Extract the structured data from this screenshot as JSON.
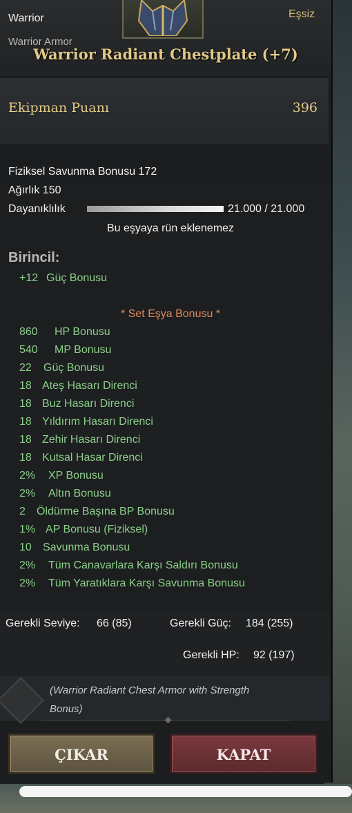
{
  "header": {
    "class": "Warrior",
    "armor_type": "Warrior Armor",
    "rarity": "Eşsiz",
    "item_name": "Warrior Radiant Chestplate (+7)"
  },
  "equipment_points": {
    "label": "Ekipman Puanı",
    "value": "396"
  },
  "stats": {
    "defense": "Fiziksel Savunma Bonusu 172",
    "weight": "Ağırlık 150",
    "durability_label": "Dayanıklılık",
    "durability_value": "21.000 / 21.000",
    "durability_fraction": 1.0,
    "no_rune": "Bu eşyaya rün eklenemez"
  },
  "primary": {
    "title": "Birincil:",
    "bonus_value": "+12",
    "bonus_name": "Güç Bonusu"
  },
  "set_bonus": {
    "title": "* Set Eşya Bonusu *",
    "items": [
      {
        "value": "860",
        "name": "HP Bonusu"
      },
      {
        "value": "540",
        "name": "MP Bonusu"
      },
      {
        "value": "22",
        "name": "Güç Bonusu"
      },
      {
        "value": "18",
        "name": "Ateş Hasarı Direnci"
      },
      {
        "value": "18",
        "name": "Buz Hasarı Direnci"
      },
      {
        "value": "18",
        "name": "Yıldırım Hasarı Direnci"
      },
      {
        "value": "18",
        "name": "Zehir Hasarı Direnci"
      },
      {
        "value": "18",
        "name": "Kutsal Hasar Direnci"
      },
      {
        "value": "2%",
        "name": "XP Bonusu"
      },
      {
        "value": "2%",
        "name": "Altın Bonusu"
      },
      {
        "value": "2",
        "name": "Öldürme Başına BP Bonusu"
      },
      {
        "value": "1%",
        "name": "AP Bonusu (Fiziksel)"
      },
      {
        "value": "10",
        "name": "Savunma Bonusu"
      },
      {
        "value": "2%",
        "name": "Tüm Canavarlara Karşı Saldırı Bonusu"
      },
      {
        "value": "2%",
        "name": "Tüm Yaratıklara Karşı Savunma Bonusu"
      }
    ]
  },
  "requirements": {
    "level_label": "Gerekli Seviye:",
    "level_value": "66 (85)",
    "str_label": "Gerekli Güç:",
    "str_value": "184 (255)",
    "hp_label": "Gerekli HP:",
    "hp_value": "92 (197)"
  },
  "description": "(Warrior Radiant Chest Armor with Strength Bonus)",
  "buttons": {
    "remove": "ÇIKAR",
    "close": "KAPAT"
  }
}
